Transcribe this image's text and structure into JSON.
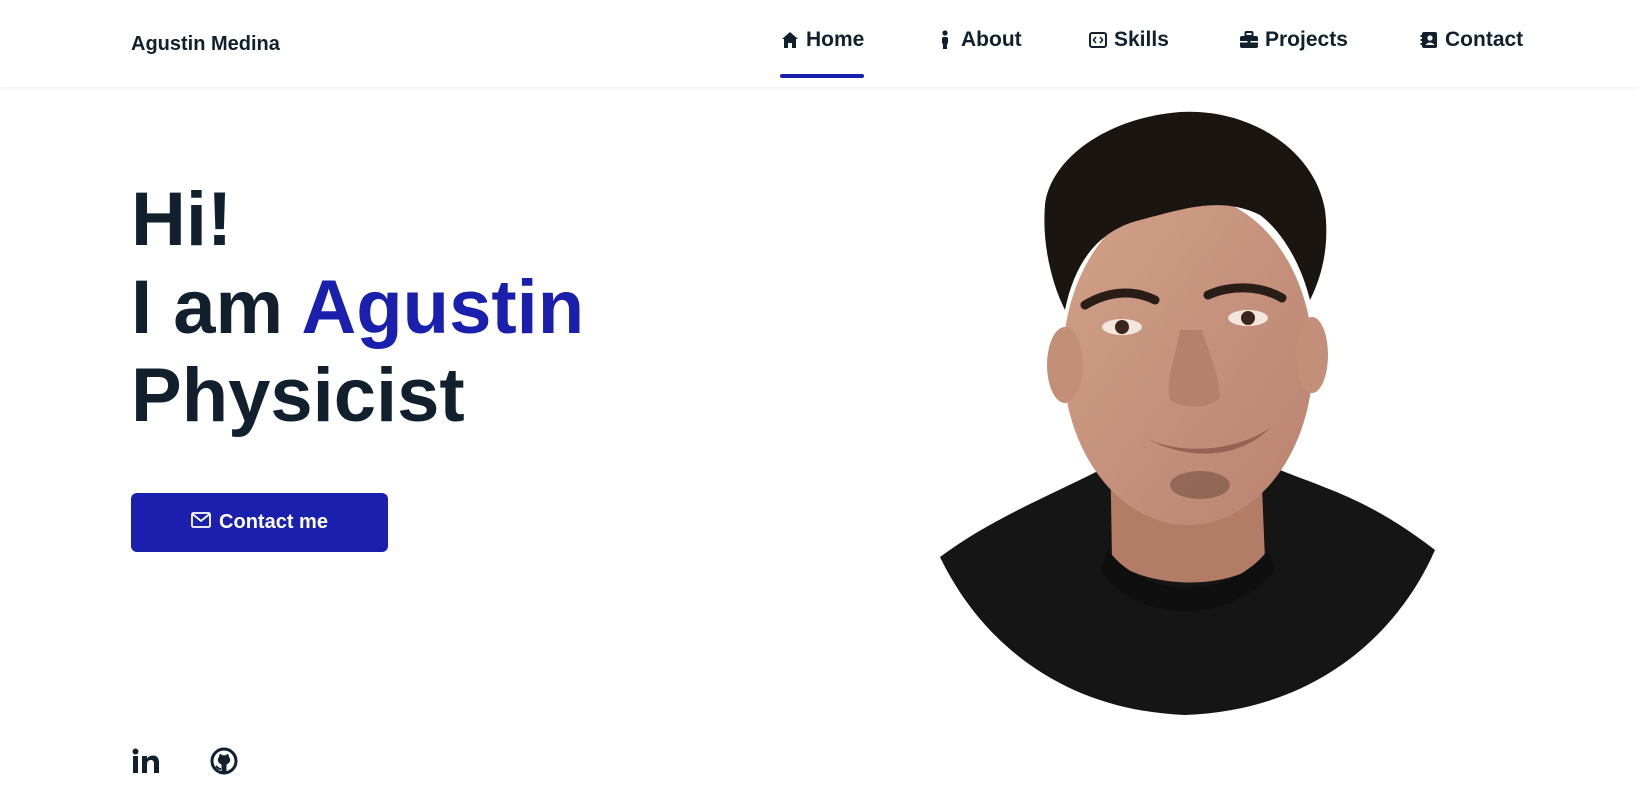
{
  "header": {
    "brand": "Agustin Medina"
  },
  "nav": {
    "items": [
      {
        "label": "Home",
        "icon": "home-icon",
        "active": true
      },
      {
        "label": "About",
        "icon": "person-icon",
        "active": false
      },
      {
        "label": "Skills",
        "icon": "code-icon",
        "active": false
      },
      {
        "label": "Projects",
        "icon": "briefcase-icon",
        "active": false
      },
      {
        "label": "Contact",
        "icon": "contact-book-icon",
        "active": false
      }
    ]
  },
  "hero": {
    "greeting": "Hi!",
    "intro_prefix": "I am",
    "name": "Agustin",
    "role": "Physicist",
    "cta_label": "Contact me",
    "cta_icon": "envelope-icon"
  },
  "portrait": {
    "alt": "Agustin Medina portrait"
  },
  "socials": [
    {
      "icon": "linkedin-icon"
    },
    {
      "icon": "github-icon"
    }
  ],
  "colors": {
    "accent": "#1a1fad",
    "text": "#12202e",
    "background": "#ffffff"
  }
}
